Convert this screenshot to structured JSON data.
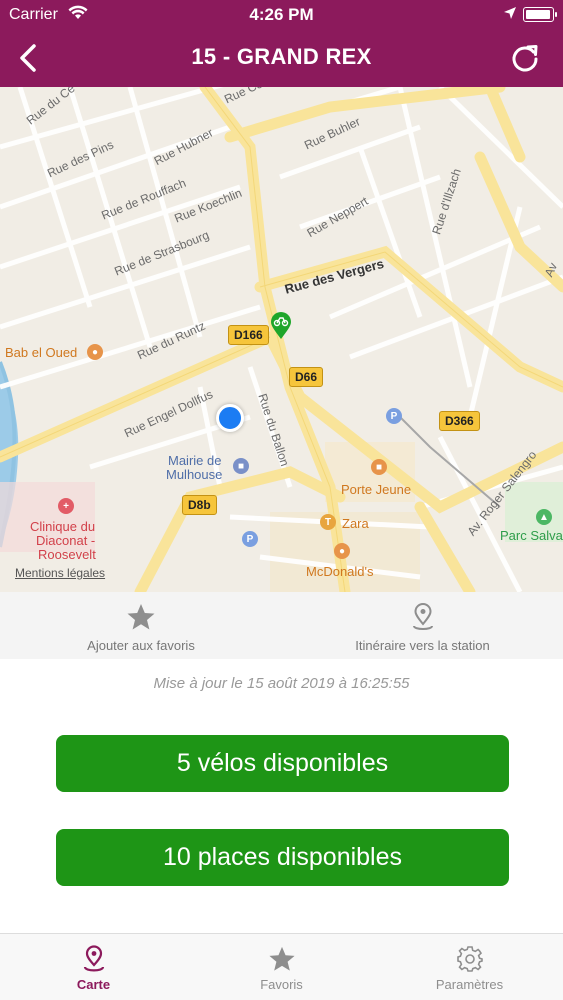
{
  "status_bar": {
    "carrier": "Carrier",
    "time": "4:26 PM"
  },
  "nav": {
    "title": "15 - GRAND REX",
    "back_icon": "chevron-left-icon",
    "refresh_icon": "refresh-icon"
  },
  "map": {
    "roads": [
      "Rue du Ce",
      "Rue Co",
      "Rue des Pins",
      "Rue Hubner",
      "Rue Buhler",
      "Rue de Rouffach",
      "Rue Koechlin",
      "Rue Neppert",
      "Rue d'Illzach",
      "Rue de Strasbourg",
      "Rue des Vergers",
      "Rue du Runtz",
      "Rue Engel Dollfus",
      "Rue du Ballon",
      "Av. Roger Salengro",
      "Av"
    ],
    "route_badges": [
      "D166",
      "D66",
      "D366",
      "D8b"
    ],
    "pois": [
      "Bab el Oued",
      "Mairie de",
      "Mulhouse",
      "Porte Jeune",
      "Zara",
      "Clinique du",
      "Diaconat -",
      "Roosevelt",
      "McDonald's",
      "Parc Salva"
    ],
    "legal_link": "Mentions légales"
  },
  "actions": {
    "favorite_label": "Ajouter aux favoris",
    "route_label": "Itinéraire vers la station"
  },
  "updated_text": "Mise à jour le 15 août 2019 à 16:25:55",
  "availability": {
    "bikes_label": "5 vélos disponibles",
    "places_label": "10 places disponibles"
  },
  "tabs": [
    {
      "label": "Carte",
      "icon": "map-pin-icon",
      "active": true
    },
    {
      "label": "Favoris",
      "icon": "star-icon",
      "active": false
    },
    {
      "label": "Paramètres",
      "icon": "gear-icon",
      "active": false
    }
  ],
  "colors": {
    "brand": "#8c1a5c",
    "available": "#1e9516"
  }
}
